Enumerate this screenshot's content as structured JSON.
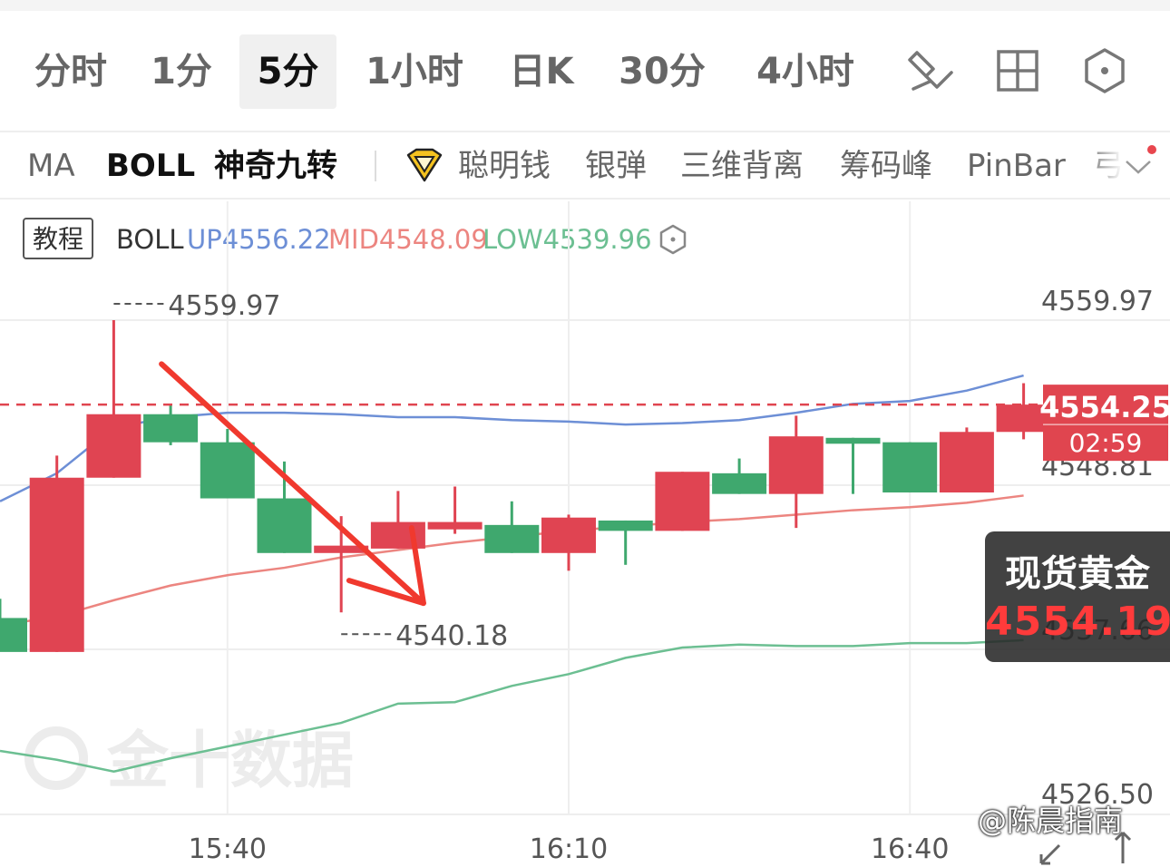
{
  "period_tabs": [
    {
      "label": "分时",
      "active": false
    },
    {
      "label": "1分",
      "active": false
    },
    {
      "label": "5分",
      "active": true
    },
    {
      "label": "1小时",
      "active": false
    },
    {
      "label": "日K",
      "active": false
    },
    {
      "label": "30分",
      "active": false
    },
    {
      "label": "4小时",
      "active": false
    }
  ],
  "toolbar_icons": [
    "draw-tool-icon",
    "layout-grid-icon",
    "settings-hexagon-icon"
  ],
  "indicator_tabs": [
    {
      "label": "MA",
      "strong": false
    },
    {
      "label": "BOLL",
      "strong": true
    },
    {
      "label": "神奇九转",
      "strong": true
    },
    {
      "label": "聪明钱",
      "strong": false,
      "badge": "diamond-badge-icon"
    },
    {
      "label": "银弹",
      "strong": false
    },
    {
      "label": "三维背离",
      "strong": false
    },
    {
      "label": "筹码峰",
      "strong": false
    },
    {
      "label": "PinBar",
      "strong": false
    },
    {
      "label": "弓",
      "strong": false
    }
  ],
  "legend": {
    "tutorial_label": "教程",
    "indicator": "BOLL",
    "up": "UP4556.22",
    "mid": "MID4548.09",
    "low": "LOW4539.96"
  },
  "colors": {
    "up_candle": "#e04452",
    "down_candle": "#3fa86e",
    "boll_up": "#6d8fd6",
    "boll_mid": "#ec8580",
    "boll_low": "#6cbf92",
    "current_price": "#e0454f",
    "arrow": "#f0392e"
  },
  "quote_card": {
    "name": "现货黄金",
    "price": "4554.19"
  },
  "watermark": {
    "brand": "金十数据",
    "author": "@陈晨指南"
  },
  "chart_data": {
    "type": "candlestick",
    "title": "",
    "xlabel": "",
    "ylabel": "",
    "ylim": [
      4526.5,
      4559.97
    ],
    "y_ticks": [
      "4559.97",
      "4548.81",
      "4537.66",
      "4526.50"
    ],
    "x_ticks": [
      {
        "index": 4,
        "label": "15:40"
      },
      {
        "index": 10,
        "label": "16:10"
      },
      {
        "index": 16,
        "label": "16:40"
      }
    ],
    "candles": [
      {
        "o": 4539.8,
        "h": 4541.1,
        "l": 4539.4,
        "c": 4537.5
      },
      {
        "o": 4537.5,
        "h": 4550.8,
        "l": 4537.5,
        "c": 4549.3
      },
      {
        "o": 4549.3,
        "h": 4559.97,
        "l": 4549.3,
        "c": 4553.6
      },
      {
        "o": 4553.6,
        "h": 4554.2,
        "l": 4551.5,
        "c": 4551.7
      },
      {
        "o": 4551.7,
        "h": 4552.6,
        "l": 4547.9,
        "c": 4547.9
      },
      {
        "o": 4547.9,
        "h": 4550.4,
        "l": 4544.2,
        "c": 4544.2
      },
      {
        "o": 4544.2,
        "h": 4546.7,
        "l": 4540.18,
        "c": 4544.7
      },
      {
        "o": 4544.5,
        "h": 4548.4,
        "l": 4544.5,
        "c": 4546.3
      },
      {
        "o": 4545.8,
        "h": 4548.7,
        "l": 4545.5,
        "c": 4546.3
      },
      {
        "o": 4546.1,
        "h": 4547.7,
        "l": 4544.2,
        "c": 4544.2
      },
      {
        "o": 4544.2,
        "h": 4546.8,
        "l": 4543.0,
        "c": 4546.6
      },
      {
        "o": 4546.4,
        "h": 4546.4,
        "l": 4543.4,
        "c": 4545.7
      },
      {
        "o": 4545.7,
        "h": 4549.7,
        "l": 4545.7,
        "c": 4549.7
      },
      {
        "o": 4549.6,
        "h": 4550.6,
        "l": 4548.2,
        "c": 4548.2
      },
      {
        "o": 4548.2,
        "h": 4553.5,
        "l": 4545.9,
        "c": 4552.1
      },
      {
        "o": 4552.0,
        "h": 4552.0,
        "l": 4548.2,
        "c": 4551.6
      },
      {
        "o": 4551.7,
        "h": 4551.7,
        "l": 4548.3,
        "c": 4548.3
      },
      {
        "o": 4548.3,
        "h": 4552.7,
        "l": 4548.3,
        "c": 4552.4
      },
      {
        "o": 4552.4,
        "h": 4555.7,
        "l": 4551.9,
        "c": 4554.25
      }
    ],
    "boll": {
      "up": [
        4547.7,
        4549.6,
        4552.7,
        4553.4,
        4553.7,
        4553.7,
        4553.6,
        4553.4,
        4553.4,
        4553.2,
        4553.1,
        4552.9,
        4553.0,
        4553.2,
        4553.7,
        4554.3,
        4554.5,
        4555.2,
        4556.22
      ],
      "mid": [
        4539.3,
        4539.9,
        4541.0,
        4542.0,
        4542.7,
        4543.2,
        4543.9,
        4544.4,
        4544.9,
        4545.3,
        4545.7,
        4546.0,
        4546.3,
        4546.5,
        4546.8,
        4547.1,
        4547.3,
        4547.6,
        4548.09
      ],
      "low": [
        4530.8,
        4530.2,
        4529.4,
        4530.3,
        4531.1,
        4531.9,
        4532.7,
        4534.0,
        4534.1,
        4535.2,
        4536.0,
        4537.1,
        4537.8,
        4538.0,
        4537.9,
        4537.9,
        4538.1,
        4538.1,
        4538.3
      ]
    },
    "current_price": "4554.25",
    "countdown": "02:59",
    "high_marker": {
      "index": 2,
      "value": 4559.97,
      "label": "4559.97"
    },
    "low_marker": {
      "index": 6,
      "value": 4540.18,
      "label": "4540.18"
    },
    "annotation_arrow": {
      "from": {
        "index": 3,
        "value": 4557.0
      },
      "to": {
        "index": 7,
        "value": 4540.8
      }
    }
  }
}
